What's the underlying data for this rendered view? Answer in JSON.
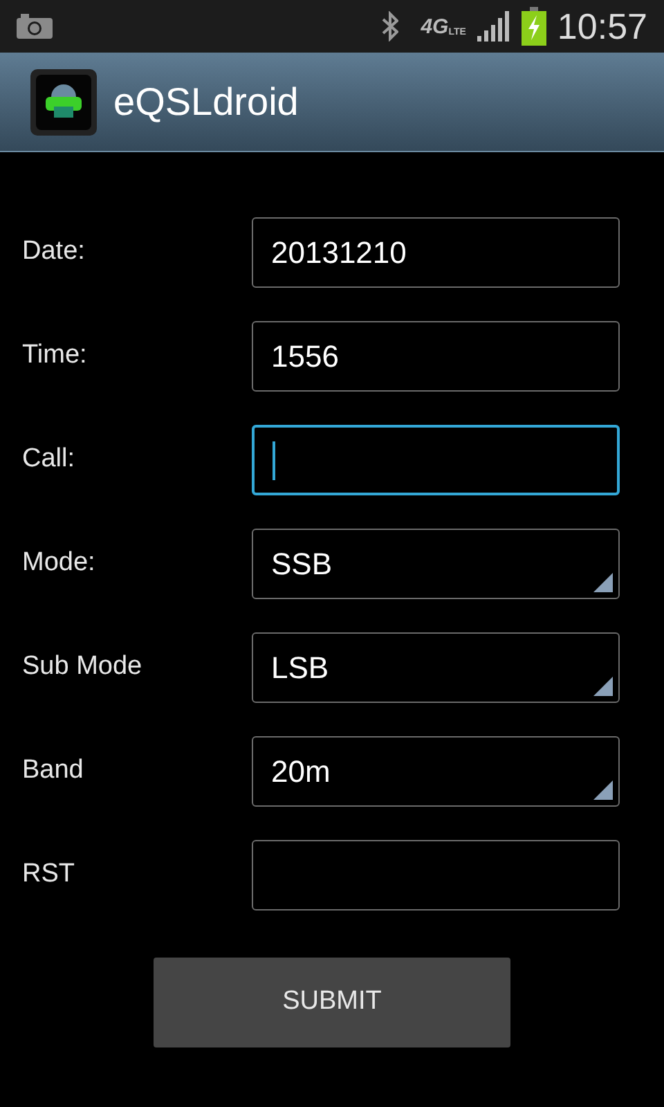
{
  "status_bar": {
    "network": "4G",
    "network_sub": "LTE",
    "time": "10:57"
  },
  "action_bar": {
    "title": "eQSLdroid"
  },
  "form": [
    {
      "label": "Date:",
      "kind": "text",
      "value": "20131210",
      "focused": false
    },
    {
      "label": "Time:",
      "kind": "text",
      "value": "1556",
      "focused": false
    },
    {
      "label": "Call:",
      "kind": "text",
      "focused": true
    },
    {
      "label": "Mode:",
      "kind": "spinner",
      "value": "SSB",
      "focused": false
    },
    {
      "label": "Sub Mode",
      "kind": "spinner",
      "value": "LSB",
      "focused": false
    },
    {
      "label": "Band",
      "kind": "spinner",
      "value": "20m",
      "focused": false
    },
    {
      "label": "RST",
      "kind": "text",
      "focused": false
    }
  ],
  "submit": "SUBMIT"
}
